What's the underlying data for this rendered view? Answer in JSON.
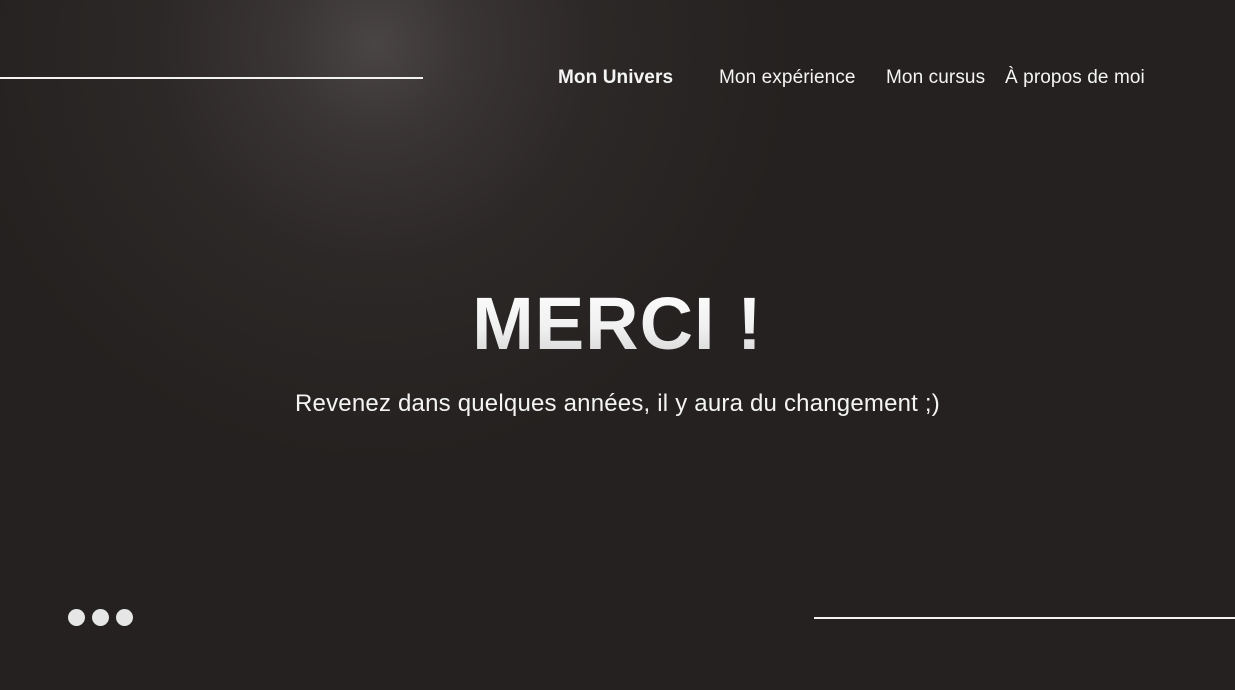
{
  "nav": {
    "items": [
      {
        "label": "Mon Univers",
        "active": true
      },
      {
        "label": "Mon expérience",
        "active": false
      },
      {
        "label": "Mon cursus",
        "active": false
      },
      {
        "label": "À propos de moi",
        "active": false
      }
    ]
  },
  "hero": {
    "title": "MERCI !",
    "subtitle": "Revenez dans quelques années, il y aura du changement ;)"
  },
  "colors": {
    "background": "#252120",
    "text": "#f2f2f2",
    "dots": "#e6e6e6"
  },
  "indicator": {
    "icon": "more-dots-icon"
  }
}
